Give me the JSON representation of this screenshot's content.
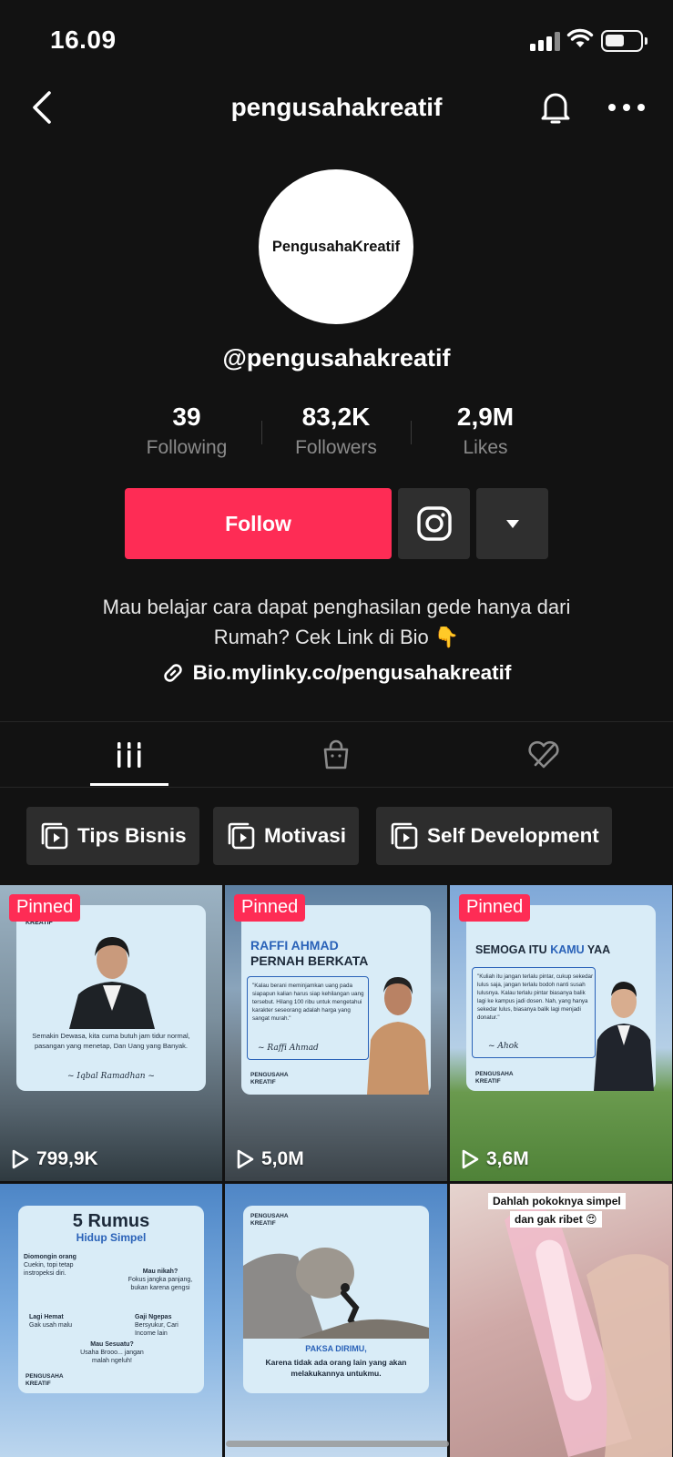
{
  "status_bar": {
    "time": "16.09"
  },
  "header": {
    "title": "pengusahakreatif"
  },
  "profile": {
    "avatar_text": "PengusahaKreatif",
    "handle": "@pengusahakreatif",
    "stats": [
      {
        "value": "39",
        "label": "Following"
      },
      {
        "value": "83,2K",
        "label": "Followers"
      },
      {
        "value": "2,9M",
        "label": "Likes"
      }
    ],
    "follow_label": "Follow",
    "bio_line1": "Mau belajar cara dapat penghasilan gede hanya dari",
    "bio_line2": "Rumah? Cek Link di Bio 👇",
    "link": "Bio.mylinky.co/pengusahakreatif"
  },
  "playlists": [
    "Tips Bisnis",
    "Motivasi",
    "Self Development"
  ],
  "videos": [
    {
      "pinned": "Pinned",
      "views": "799,9K",
      "card_brand": "KREATIF",
      "quote": "Semakin Dewasa, kita cuma butuh jam tidur normal, pasangan yang menetap, Dan Uang yang Banyak.",
      "sign": "~ Iqbal Ramadhan ~"
    },
    {
      "pinned": "Pinned",
      "views": "5,0M",
      "headline1": "RAFFI AHMAD",
      "headline2": "PERNAH BERKATA",
      "quote": "\"Kalau berani meminjamkan uang pada siapapun kalian harus siap kehilangan uang tersebut. Hilang 100 ribu untuk mengetahui karakter seseorang adalah harga yang sangat murah.\"",
      "sign": "~ Raffi Ahmad",
      "brand1": "PENGUSAHA",
      "brand2": "KREATIF"
    },
    {
      "pinned": "Pinned",
      "views": "3,6M",
      "headline_a": "SEMOGA ITU ",
      "headline_b": "KAMU",
      "headline_c": " YAA",
      "quote": "\"Kuliah itu jangan terlalu pintar, cukup sekedar lulus saja, jangan terlalu bodoh nanti susah lulusnya. Kalau terlalu pintar biasanya balik lagi ke kampus jadi dosen. Nah, yang hanya sekedar lulus, biasanya balik lagi menjadi donatur.\"",
      "sign": "~ Ahok",
      "brand1": "PENGUSAHA",
      "brand2": "KREATIF"
    },
    {
      "title1": "5 Rumus",
      "title2": "Hidup Simpel",
      "items": [
        {
          "h": "Diomongin orang",
          "t": "Cuekin, topi tetap instropeksi diri."
        },
        {
          "h": "Mau nikah?",
          "t": "Fokus jangka panjang, bukan karena gengsi"
        },
        {
          "h": "Lagi Hemat",
          "t": "Gak usah malu"
        },
        {
          "h": "Gaji Ngepas",
          "t": "Bersyukur, Cari Income lain"
        },
        {
          "h": "Mau Sesuatu?",
          "t": "Usaha Brooo... jangan malah ngeluh!"
        }
      ],
      "brand1": "PENGUSAHA",
      "brand2": "KREATIF"
    },
    {
      "brand1": "PENGUSAHA",
      "brand2": "KREATIF",
      "headline": "PAKSA DIRIMU,",
      "text": "Karena tidak ada orang lain yang akan melakukannya untukmu."
    },
    {
      "caption1": "Dahlah pokoknya simpel",
      "caption2": "dan gak ribet 😍"
    }
  ],
  "colors": {
    "accent": "#fe2c55",
    "bg": "#121212",
    "button_dark": "#2f2f2f"
  }
}
